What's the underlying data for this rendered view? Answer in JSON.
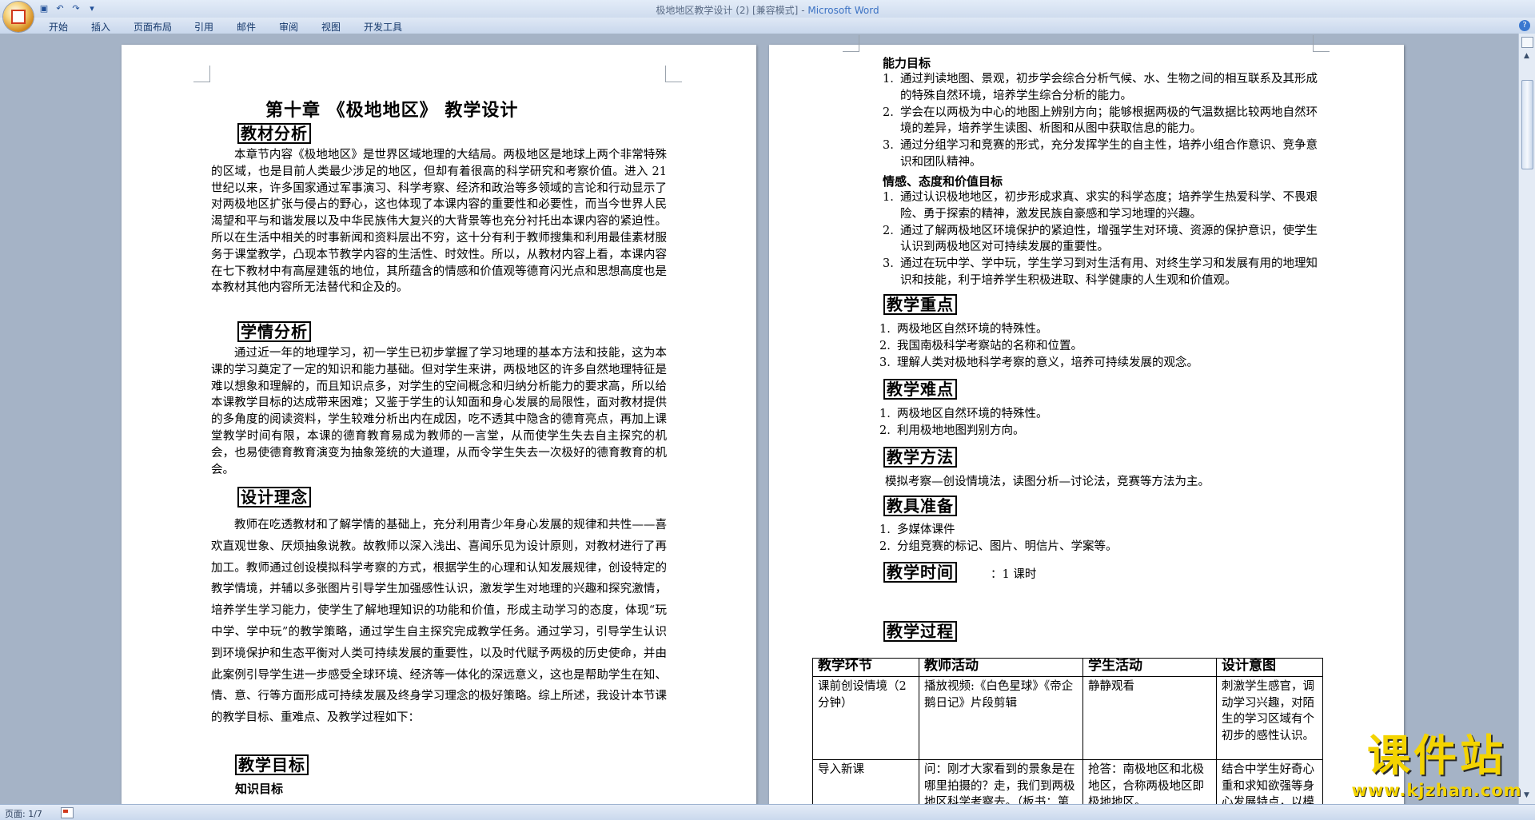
{
  "window": {
    "doc_title": "极地地区教学设计 (2) [兼容模式]",
    "separator": " - ",
    "app_name": "Microsoft Word"
  },
  "ribbon": {
    "tabs": [
      "开始",
      "插入",
      "页面布局",
      "引用",
      "邮件",
      "审阅",
      "视图",
      "开发工具"
    ]
  },
  "page1": {
    "chapter_title": "第十章 《极地地区》 教学设计",
    "sections": {
      "h1": "教材分析",
      "p1": "本章节内容《极地地区》是世界区域地理的大结局。两极地区是地球上两个非常特殊的区域，也是目前人类最少涉足的地区，但却有着很高的科学研究和考察价值。进入 21 世纪以来，许多国家通过军事演习、科学考察、经济和政治等多领域的言论和行动显示了对两极地区扩张与侵占的野心，这也体现了本课内容的重要性和必要性，而当今世界人民渴望和平与和谐发展以及中华民族伟大复兴的大背景等也充分衬托出本课内容的紧迫性。所以在生活中相关的时事新闻和资料层出不穷，这十分有利于教师搜集和利用最佳素材服务于课堂教学，凸现本节教学内容的生活性、时效性。所以，从教材内容上看，本课内容在七下教材中有高屋建瓴的地位，其所蕴含的情感和价值观等德育闪光点和思想高度也是本教材其他内容所无法替代和企及的。",
      "h2": "学情分析",
      "p2": "通过近一年的地理学习，初一学生已初步掌握了学习地理的基本方法和技能，这为本课的学习奠定了一定的知识和能力基础。但对学生来讲，两极地区的许多自然地理特征是难以想象和理解的，而且知识点多，对学生的空间概念和归纳分析能力的要求高，所以给本课教学目标的达成带来困难；又鉴于学生的认知面和身心发展的局限性，面对教材提供的多角度的阅读资料，学生较难分析出内在成因，吃不透其中隐含的德育亮点，再加上课堂教学时间有限，本课的德育教育易成为教师的一言堂，从而使学生失去自主探究的机会，也易使德育教育演变为抽象笼统的大道理，从而令学生失去一次极好的德育教育的机会。",
      "h3": "设计理念",
      "p3": "教师在吃透教材和了解学情的基础上，充分利用青少年身心发展的规律和共性——喜欢直观世象、厌烦抽象说教。故教师以深入浅出、喜闻乐见为设计原则，对教材进行了再加工。教师通过创设模拟科学考察的方式，根据学生的心理和认知发展规律，创设特定的教学情境，并辅以多张图片引导学生加强感性认识，激发学生对地理的兴趣和探究激情，培养学生学习能力，使学生了解地理知识的功能和价值，形成主动学习的态度，体现“玩中学、学中玩”的教学策略，通过学生自主探究完成教学任务。通过学习，引导学生认识到环境保护和生态平衡对人类可持续发展的重要性，以及时代赋予两极的历史使命，并由此案例引导学生进一步感受全球环境、经济等一体化的深远意义，这也是帮助学生在知、情、意、行等方面形成可持续发展及终身学习理念的极好策略。综上所述，我设计本节课的教学目标、重难点、及教学过程如下：",
      "h4": "教学目标",
      "sub1": "知识目标"
    }
  },
  "page2": {
    "ability_title": "能力目标",
    "ability_items": [
      {
        "n": "1.",
        "t": "通过判读地图、景观，初步学会综合分析气候、水、生物之间的相互联系及其形成的特殊自然环境，培养学生综合分析的能力。"
      },
      {
        "n": "2.",
        "t": "学会在以两极为中心的地图上辨别方向；能够根据两极的气温数据比较两地自然环境的差异，培养学生读图、析图和从图中获取信息的能力。"
      },
      {
        "n": "3.",
        "t": "通过分组学习和竞赛的形式，充分发挥学生的自主性，培养小组合作意识、竞争意识和团队精神。"
      }
    ],
    "emotion_title": "情感、态度和价值目标",
    "emotion_items": [
      {
        "n": "1.",
        "t": "通过认识极地地区，初步形成求真、求实的科学态度；培养学生热爱科学、不畏艰险、勇于探索的精神，激发民族自豪感和学习地理的兴趣。"
      },
      {
        "n": "2.",
        "t": "通过了解两极地区环境保护的紧迫性，增强学生对环境、资源的保护意识，使学生认识到两极地区对可持续发展的重要性。"
      },
      {
        "n": "3.",
        "t": "通过在玩中学、学中玩，学生学习到对生活有用、对终生学习和发展有用的地理知识和技能，利于培养学生积极进取、科学健康的人生观和价值观。"
      }
    ],
    "focus_title": "教学重点",
    "focus_items": [
      {
        "n": "1.",
        "t": "两极地区自然环境的特殊性。"
      },
      {
        "n": "2.",
        "t": "我国南极科学考察站的名称和位置。"
      },
      {
        "n": "3.",
        "t": "理解人类对极地科学考察的意义，培养可持续发展的观念。"
      }
    ],
    "difficulty_title": "教学难点",
    "difficulty_items": [
      {
        "n": "1.",
        "t": "两极地区自然环境的特殊性。"
      },
      {
        "n": "2.",
        "t": "利用极地地图判别方向。"
      }
    ],
    "method_title": "教学方法",
    "method_text": "模拟考察—创设情境法，读图分析—讨论法，竞赛等方法为主。",
    "tools_title": "教具准备",
    "tools_items": [
      {
        "n": "1.",
        "t": "多媒体课件"
      },
      {
        "n": "2.",
        "t": "分组竞赛的标记、图片、明信片、学案等。"
      }
    ],
    "time_title": "教学时间",
    "time_value": "：1 课时",
    "process_title": "教学过程",
    "table": {
      "headers": [
        "教学环节",
        "教师活动",
        "学生活动",
        "设计意图"
      ],
      "rows": [
        [
          "课前创设情境（2 分钟）",
          "播放视频:《白色星球》《帝企鹅日记》片段剪辑",
          "静静观看",
          "刺激学生感官，调动学习兴趣，对陌生的学习区域有个初步的感性认识。"
        ],
        [
          "导入新课",
          "问：刚才大家看到的景象是在哪里拍摄的？走，我们到两极地区科学考察去。（板书：第十章极地地区）",
          "抢答：南极地区和北极地区，合称两极地区即极地地区。",
          "结合中学生好奇心重和求知欲强等身心发展特点，以模拟科考"
        ]
      ]
    }
  },
  "status": {
    "page_indicator": "页面: 1/7"
  },
  "watermark": {
    "brand": "课件站",
    "url": "www.kjzhan.com"
  }
}
